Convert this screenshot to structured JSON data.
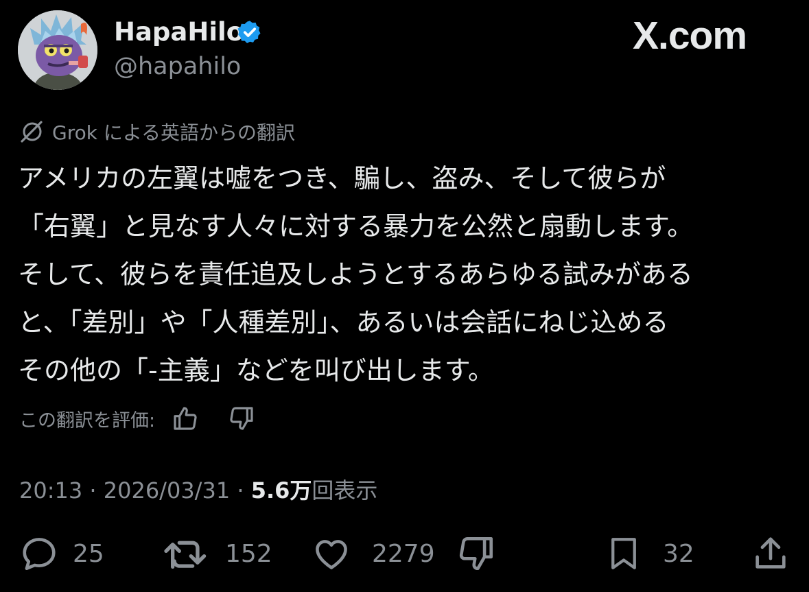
{
  "author": {
    "display_name": "HapaHilo",
    "handle": "@hapahilo",
    "verified": true
  },
  "site_watermark": "X.com",
  "translation": {
    "label": "Grok による英語からの翻訳"
  },
  "tweet": {
    "lines": [
      "アメリカの左翼は嘘をつき、騙し、盗み、そして彼らが",
      "「右翼」と見なす人々に対する暴力を公然と扇動します。",
      "そして、彼らを責任追及しようとするあらゆる試みがある",
      "と、「差別」や「人種差別」、あるいは会話にねじ込める",
      "その他の「-主義」などを叫び出します。"
    ]
  },
  "rating": {
    "label": "この翻訳を評価:"
  },
  "meta": {
    "time": "20:13",
    "separator": " · ",
    "date": "2026/03/31",
    "separator2": " · ",
    "views_count": "5.6万",
    "views_label": "回表示"
  },
  "actions": {
    "replies": "25",
    "reposts": "152",
    "likes": "2279",
    "bookmarks": "32"
  },
  "colors": {
    "background": "#000000",
    "primary_text": "#e7e9ea",
    "secondary_text": "#8b9096",
    "verified_blue": "#1d9bf0"
  },
  "icons": {
    "verified": "verified-badge-icon",
    "grok": "grok-icon",
    "reply": "reply-icon",
    "repost": "repost-icon",
    "like": "heart-icon",
    "downvote": "thumbs-down-icon",
    "bookmark": "bookmark-icon",
    "share": "share-icon"
  }
}
